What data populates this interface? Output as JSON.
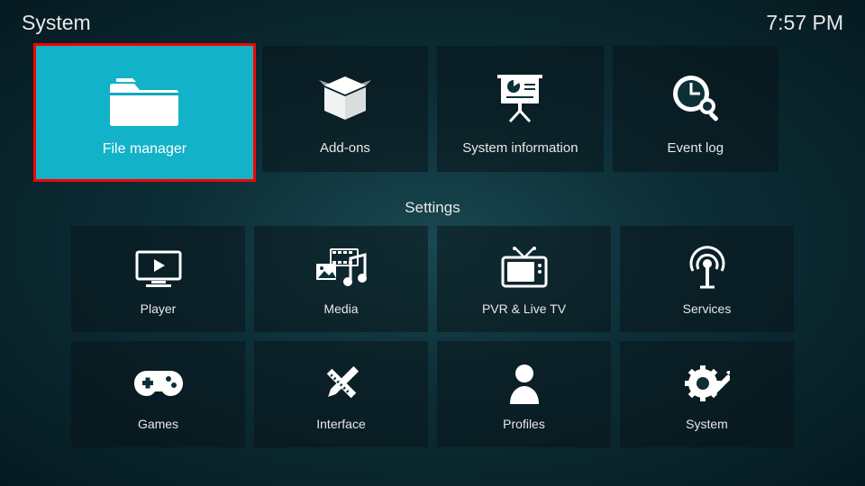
{
  "header": {
    "title": "System",
    "clock": "7:57 PM"
  },
  "topRow": [
    {
      "label": "File manager"
    },
    {
      "label": "Add-ons"
    },
    {
      "label": "System information"
    },
    {
      "label": "Event log"
    }
  ],
  "sectionTitle": "Settings",
  "grid": [
    {
      "label": "Player"
    },
    {
      "label": "Media"
    },
    {
      "label": "PVR & Live TV"
    },
    {
      "label": "Services"
    },
    {
      "label": "Games"
    },
    {
      "label": "Interface"
    },
    {
      "label": "Profiles"
    },
    {
      "label": "System"
    }
  ]
}
